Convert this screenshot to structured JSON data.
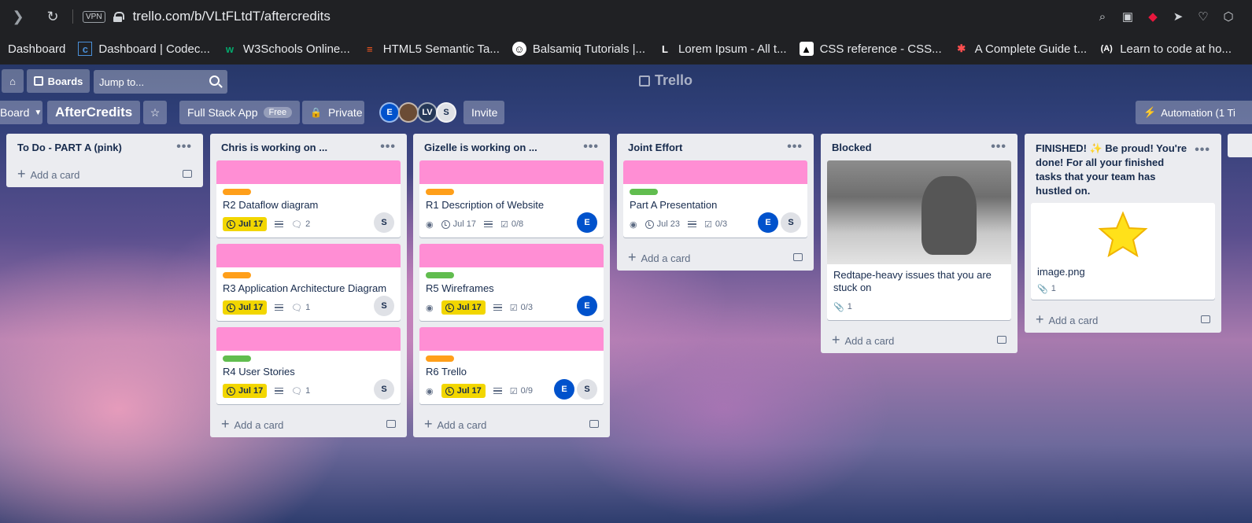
{
  "browser": {
    "url": "trello.com/b/VLtFLtdT/aftercredits",
    "vpn": "VPN"
  },
  "bookmarks": [
    {
      "label": "Dashboard",
      "icon": "bookmark-icon"
    },
    {
      "label": "Dashboard | Codec...",
      "icon": "codec-icon"
    },
    {
      "label": "W3Schools Online...",
      "icon": "w3schools-icon"
    },
    {
      "label": "HTML5 Semantic Ta...",
      "icon": "html5-icon"
    },
    {
      "label": "Balsamiq Tutorials |...",
      "icon": "balsamiq-icon"
    },
    {
      "label": "Lorem Ipsum - All t...",
      "icon": "lorem-icon"
    },
    {
      "label": "CSS reference - CSS...",
      "icon": "css-icon"
    },
    {
      "label": "A Complete Guide t...",
      "icon": "guide-icon"
    },
    {
      "label": "Learn to code at ho...",
      "icon": "codecademy-icon"
    }
  ],
  "header": {
    "boards": "Boards",
    "search_placeholder": "Jump to...",
    "logo": "Trello"
  },
  "boardbar": {
    "view": "Board",
    "title": "AfterCredits",
    "workspace": "Full Stack App",
    "workspace_badge": "Free",
    "visibility": "Private",
    "invite": "Invite",
    "automation": "Automation (1 Ti",
    "members": [
      {
        "initials": "E",
        "color": "#0052cc"
      },
      {
        "initials": "",
        "color": "#6b4c35"
      },
      {
        "initials": "LV",
        "color": "#253858"
      },
      {
        "initials": "S",
        "color": "#dfe1e6"
      }
    ]
  },
  "lists": [
    {
      "title": "To Do - PART A (pink)",
      "add": "Add a card",
      "cards": []
    },
    {
      "title": "Chris is working on ...",
      "add": "Add a card",
      "cards": [
        {
          "title": "R2 Dataflow diagram",
          "label": "#ff9f1a",
          "due": "Jul 17",
          "comments": "2",
          "members": [
            "S"
          ]
        },
        {
          "title": "R3 Application Architecture Diagram",
          "label": "#ff9f1a",
          "due": "Jul 17",
          "comments": "1",
          "members": [
            "S"
          ]
        },
        {
          "title": "R4 User Stories",
          "label": "#61bd4f",
          "due": "Jul 17",
          "comments": "1",
          "members": [
            "S"
          ]
        }
      ]
    },
    {
      "title": "Gizelle is working on ...",
      "add": "Add a card",
      "cards": [
        {
          "title": "R1 Description of Website",
          "label": "#ff9f1a",
          "due": "Jul 17",
          "checklist": "0/8",
          "members": [
            "E"
          ]
        },
        {
          "title": "R5 Wireframes",
          "label": "#61bd4f",
          "due": "Jul 17",
          "checklist": "0/3",
          "members": [
            "E"
          ]
        },
        {
          "title": "R6 Trello",
          "label": "#ff9f1a",
          "due": "Jul 17",
          "checklist": "0/9",
          "members": [
            "E",
            "S"
          ]
        }
      ]
    },
    {
      "title": "Joint Effort",
      "add": "Add a card",
      "cards": [
        {
          "title": "Part A Presentation",
          "label": "#61bd4f",
          "due": "Jul 23",
          "checklist": "0/3",
          "members": [
            "E",
            "S"
          ]
        }
      ]
    },
    {
      "title": "Blocked",
      "add": "Add a card",
      "cards": [
        {
          "title": "Redtape-heavy issues that you are stuck on",
          "attachments": "1"
        }
      ]
    },
    {
      "title": "FINISHED! ✨ Be proud! You're done! For all your finished tasks that your team has hustled on.",
      "add": "Add a card",
      "cards": [
        {
          "title": "image.png",
          "attachments": "1"
        }
      ]
    }
  ],
  "colors": {
    "cover": "#ff8ed4",
    "due": "#f2d600"
  }
}
